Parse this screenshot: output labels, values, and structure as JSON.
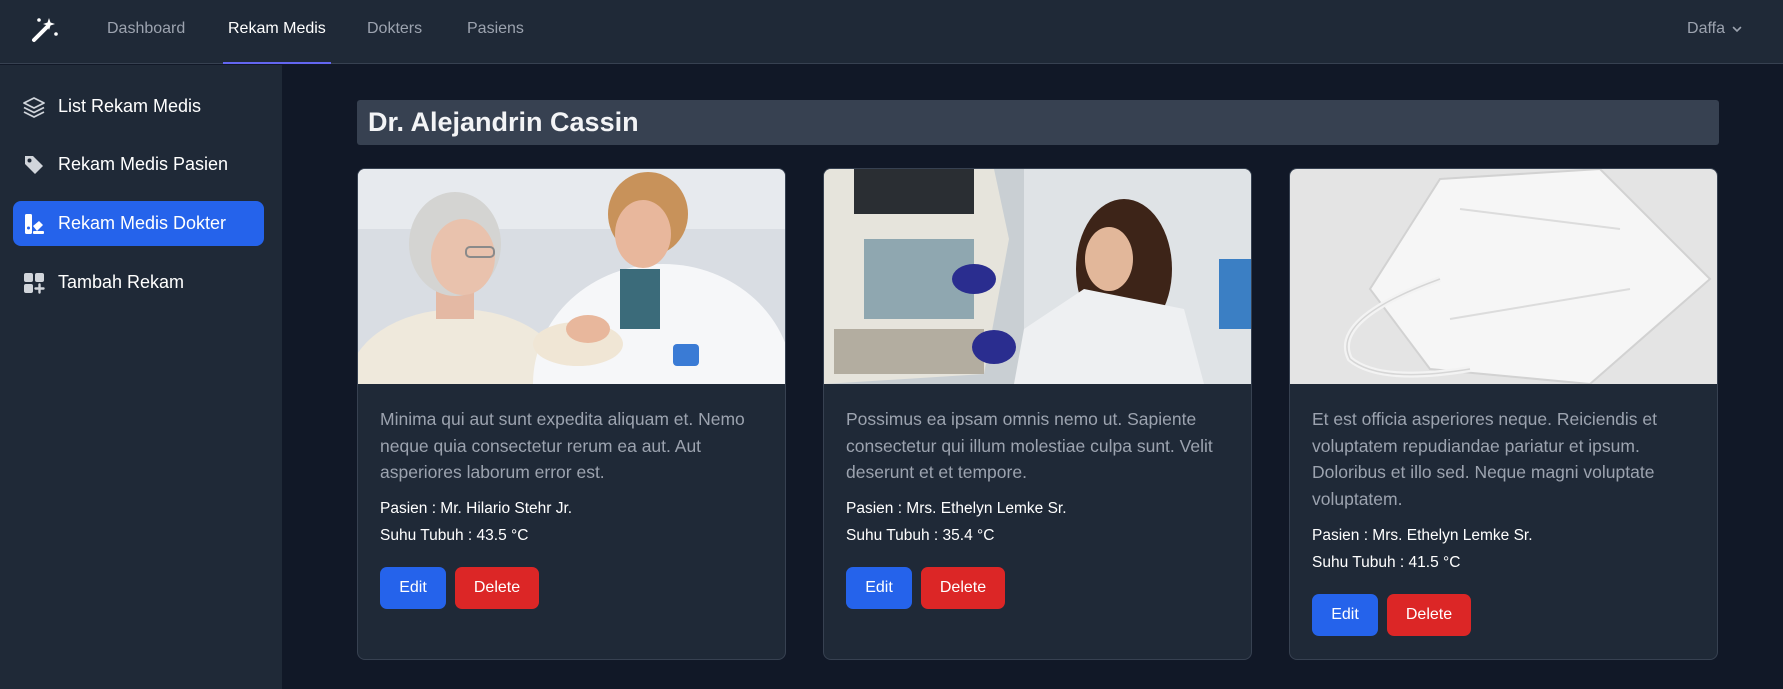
{
  "nav": {
    "links": [
      "Dashboard",
      "Rekam Medis",
      "Dokters",
      "Pasiens"
    ],
    "active": "Rekam Medis",
    "user": "Daffa"
  },
  "sidebar": {
    "items": [
      {
        "label": "List Rekam Medis",
        "icon": "layers-icon",
        "active": false
      },
      {
        "label": "Rekam Medis Pasien",
        "icon": "tag-icon",
        "active": false
      },
      {
        "label": "Rekam Medis Dokter",
        "icon": "doctor-icon",
        "active": true
      },
      {
        "label": "Tambah Rekam",
        "icon": "grid-plus-icon",
        "active": false
      }
    ]
  },
  "main": {
    "doctor_name": "Dr. Alejandrin Cassin",
    "cards": [
      {
        "image": "doctor-patient-vaccination-photo",
        "description": "Minima qui aut sunt expedita aliquam et. Nemo neque quia consectetur rerum ea aut. Aut asperiores laborum error est.",
        "patient": "Pasien : Mr. Hilario Stehr Jr.",
        "temperature": "Suhu Tubuh : 43.5 °C",
        "edit_label": "Edit",
        "delete_label": "Delete"
      },
      {
        "image": "lab-researcher-photo",
        "description": "Possimus ea ipsam omnis nemo ut. Sapiente consectetur qui illum molestiae culpa sunt. Velit deserunt et et tempore.",
        "patient": "Pasien : Mrs. Ethelyn Lemke Sr.",
        "temperature": "Suhu Tubuh : 35.4 °C",
        "edit_label": "Edit",
        "delete_label": "Delete"
      },
      {
        "image": "kn95-mask-photo",
        "description": "Et est officia asperiores neque. Reiciendis et voluptatem repudiandae pariatur et ipsum. Doloribus et illo sed. Neque magni voluptate voluptatem.",
        "patient": "Pasien : Mrs. Ethelyn Lemke Sr.",
        "temperature": "Suhu Tubuh : 41.5 °C",
        "edit_label": "Edit",
        "delete_label": "Delete"
      }
    ]
  },
  "colors": {
    "background": "#111827",
    "panel": "#1f2937",
    "primary": "#2563eb",
    "danger": "#dc2626",
    "nav_indicator": "#6366f1"
  }
}
